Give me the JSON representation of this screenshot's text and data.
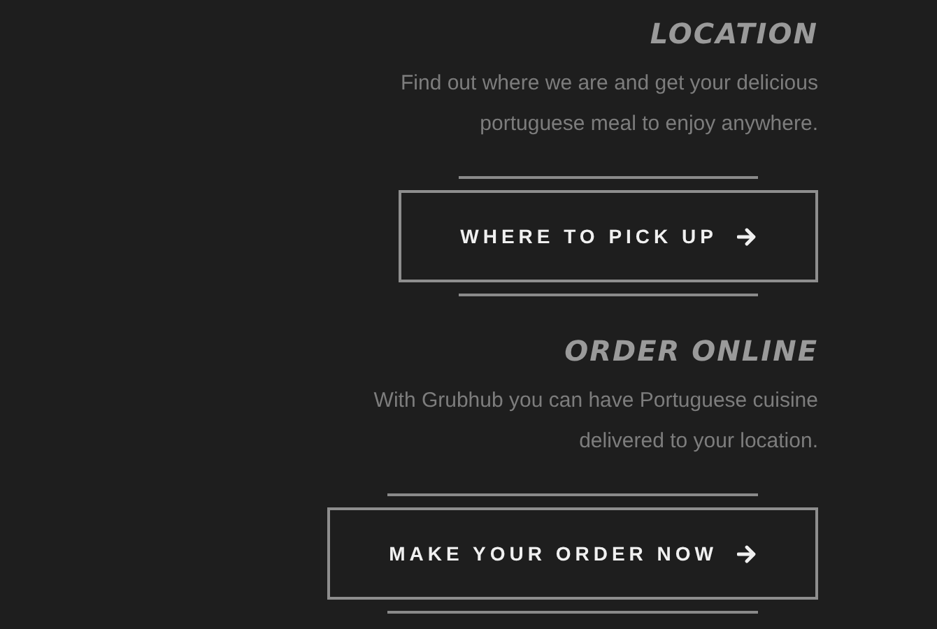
{
  "sections": [
    {
      "heading": "LOCATION",
      "lines": [
        "Find out where we are and get your delicious",
        "portuguese meal to enjoy anywhere."
      ],
      "button": "WHERE TO PICK UP"
    },
    {
      "heading": "ORDER ONLINE",
      "lines": [
        "With Grubhub you can have Portuguese cuisine",
        "delivered to your location."
      ],
      "button": "MAKE YOUR ORDER NOW"
    }
  ]
}
